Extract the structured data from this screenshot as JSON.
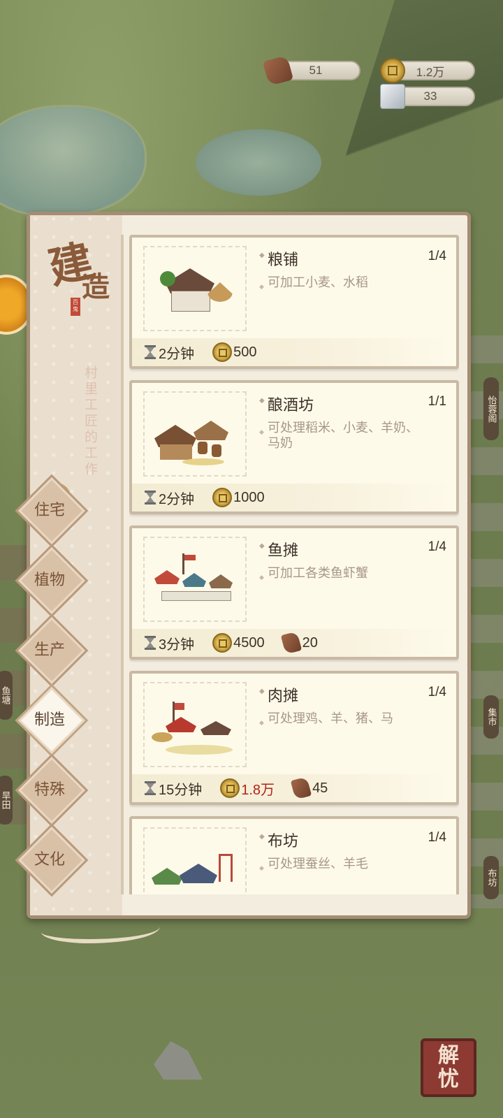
{
  "resources": {
    "wood": "51",
    "coins": "1.2万",
    "stone": "33"
  },
  "panel": {
    "title_char1": "建",
    "title_char2": "造",
    "seal": "百鬼",
    "subtitle": "村里工匠的工作"
  },
  "categories": [
    {
      "label": "住宅",
      "active": false
    },
    {
      "label": "植物",
      "active": false
    },
    {
      "label": "生产",
      "active": false
    },
    {
      "label": "制造",
      "active": true
    },
    {
      "label": "特殊",
      "active": false
    },
    {
      "label": "文化",
      "active": false
    }
  ],
  "buildings": [
    {
      "name": "粮铺",
      "count": "1/4",
      "desc": "可加工小麦、水稻",
      "time": "2分钟",
      "coins": "500",
      "wood": ""
    },
    {
      "name": "酿酒坊",
      "count": "1/1",
      "desc": "可处理稻米、小麦、羊奶、马奶",
      "time": "2分钟",
      "coins": "1000",
      "wood": ""
    },
    {
      "name": "鱼摊",
      "count": "1/4",
      "desc": "可加工各类鱼虾蟹",
      "time": "3分钟",
      "coins": "4500",
      "wood": "20"
    },
    {
      "name": "肉摊",
      "count": "1/4",
      "desc": "可处理鸡、羊、猪、马",
      "time": "15分钟",
      "coins": "1.8万",
      "wood": "45",
      "coins_insufficient": true
    },
    {
      "name": "布坊",
      "count": "1/4",
      "desc": "可处理蚕丝、羊毛",
      "time": "",
      "coins": "",
      "wood": ""
    }
  ],
  "map_labels": {
    "right1": "怡蓉阁",
    "right2": "集市",
    "right3": "布坊",
    "left1": "鱼塘",
    "left2": "旱田"
  },
  "help_button": {
    "char1": "解",
    "char2": "忧"
  }
}
